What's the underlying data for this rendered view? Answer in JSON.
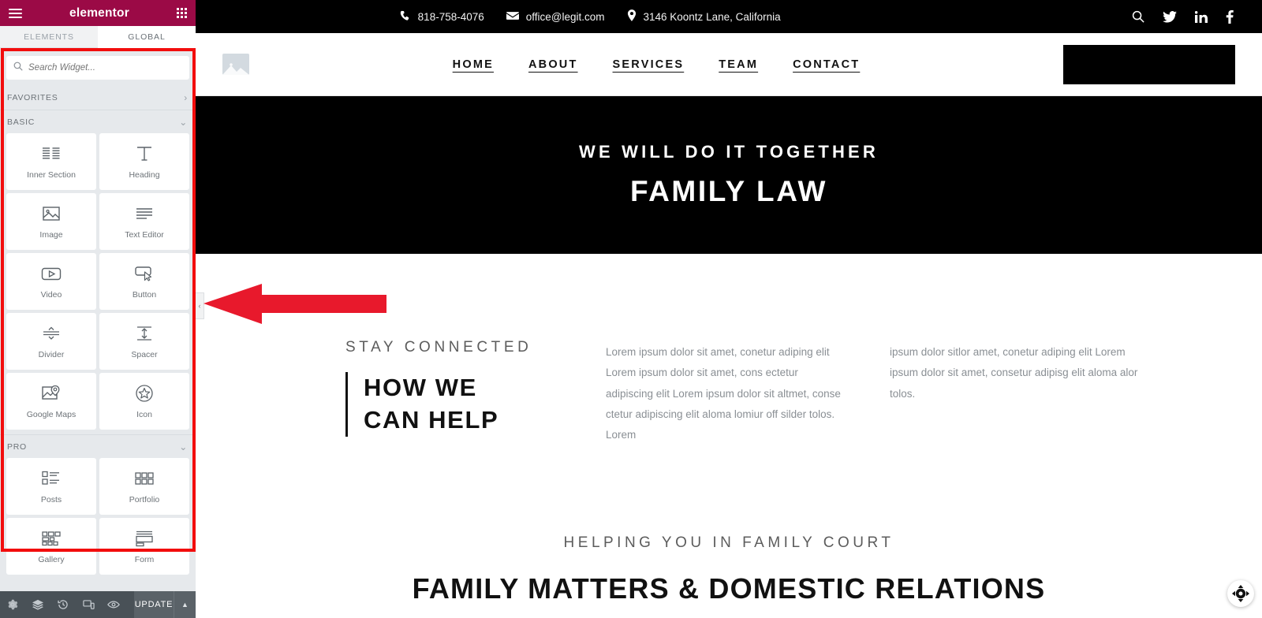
{
  "panel": {
    "brand": "elementor",
    "menu_icon": "hamburger-icon",
    "apps_icon": "grid-apps-icon",
    "tabs": [
      {
        "label": "ELEMENTS",
        "active": true
      },
      {
        "label": "GLOBAL",
        "active": false
      }
    ],
    "search": {
      "placeholder": "Search Widget...",
      "value": "",
      "icon": "search-icon"
    },
    "categories": [
      {
        "label": "FAVORITES",
        "chevron": "›",
        "expanded": false
      },
      {
        "label": "BASIC",
        "chevron": "⌄",
        "expanded": true
      },
      {
        "label": "PRO",
        "chevron": "⌄",
        "expanded": true
      }
    ],
    "basic_widgets": [
      {
        "label": "Inner Section",
        "icon": "inner-section-icon"
      },
      {
        "label": "Heading",
        "icon": "heading-icon"
      },
      {
        "label": "Image",
        "icon": "image-icon"
      },
      {
        "label": "Text Editor",
        "icon": "text-editor-icon"
      },
      {
        "label": "Video",
        "icon": "video-icon"
      },
      {
        "label": "Button",
        "icon": "button-icon"
      },
      {
        "label": "Divider",
        "icon": "divider-icon"
      },
      {
        "label": "Spacer",
        "icon": "spacer-icon"
      },
      {
        "label": "Google Maps",
        "icon": "google-maps-icon"
      },
      {
        "label": "Icon",
        "icon": "star-icon"
      }
    ],
    "pro_widgets": [
      {
        "label": "Posts",
        "icon": "posts-icon"
      },
      {
        "label": "Portfolio",
        "icon": "portfolio-icon"
      },
      {
        "label": "Gallery",
        "icon": "gallery-icon"
      },
      {
        "label": "Form",
        "icon": "form-icon"
      }
    ],
    "footer": {
      "icons": [
        "settings-gear-icon",
        "layers-navigator-icon",
        "history-icon",
        "responsive-mode-icon",
        "preview-eye-icon"
      ],
      "update_label": "UPDATE",
      "caret": "▲"
    },
    "collapse_handle": {
      "icon": "chevron-left-icon",
      "glyph": "‹"
    },
    "annotation": {
      "box_color": "#f20d0d",
      "arrow_color": "#e8192c",
      "arrow_direction": "left"
    }
  },
  "site": {
    "topbar": {
      "phone": "818-758-4076",
      "email": "office@legit.com",
      "address": "3146 Koontz Lane, California",
      "phone_icon": "phone-icon",
      "email_icon": "envelope-icon",
      "address_icon": "map-pin-icon",
      "social": [
        "search-icon",
        "twitter-icon",
        "linkedin-icon",
        "facebook-icon"
      ]
    },
    "nav": {
      "logo": "image-placeholder-logo",
      "links": [
        "HOME",
        "ABOUT",
        "SERVICES",
        "TEAM",
        "CONTACT"
      ],
      "cta_box": ""
    },
    "hero": {
      "subtitle": "WE WILL DO IT TOGETHER",
      "title": "FAMILY LAW"
    },
    "connected": {
      "eyebrow": "STAY CONNECTED",
      "heading_line1": "HOW WE",
      "heading_line2": "CAN HELP",
      "paragraph_left": "Lorem ipsum dolor sit amet, conetur adiping elit Lorem ipsum dolor sit amet, cons ectetur adipiscing elit Lorem ipsum dolor sit altmet, conse ctetur adipiscing elit aloma lomiur off silder tolos. Lorem",
      "paragraph_right": "ipsum dolor sitlor amet, conetur adiping elit Lorem ipsum dolor sit amet, consetur adipisg elit aloma alor tolos."
    },
    "bottom": {
      "eyebrow": "HELPING YOU IN FAMILY COURT",
      "title": "FAMILY MATTERS & DOMESTIC RELATIONS"
    },
    "move_handle": "move-widget-handle"
  },
  "colors": {
    "brand": "#9b0a46",
    "panel_bg": "#e6e9ec",
    "footer_bg": "#495157",
    "annotation_red": "#f20d0d",
    "site_dark": "#000000"
  }
}
